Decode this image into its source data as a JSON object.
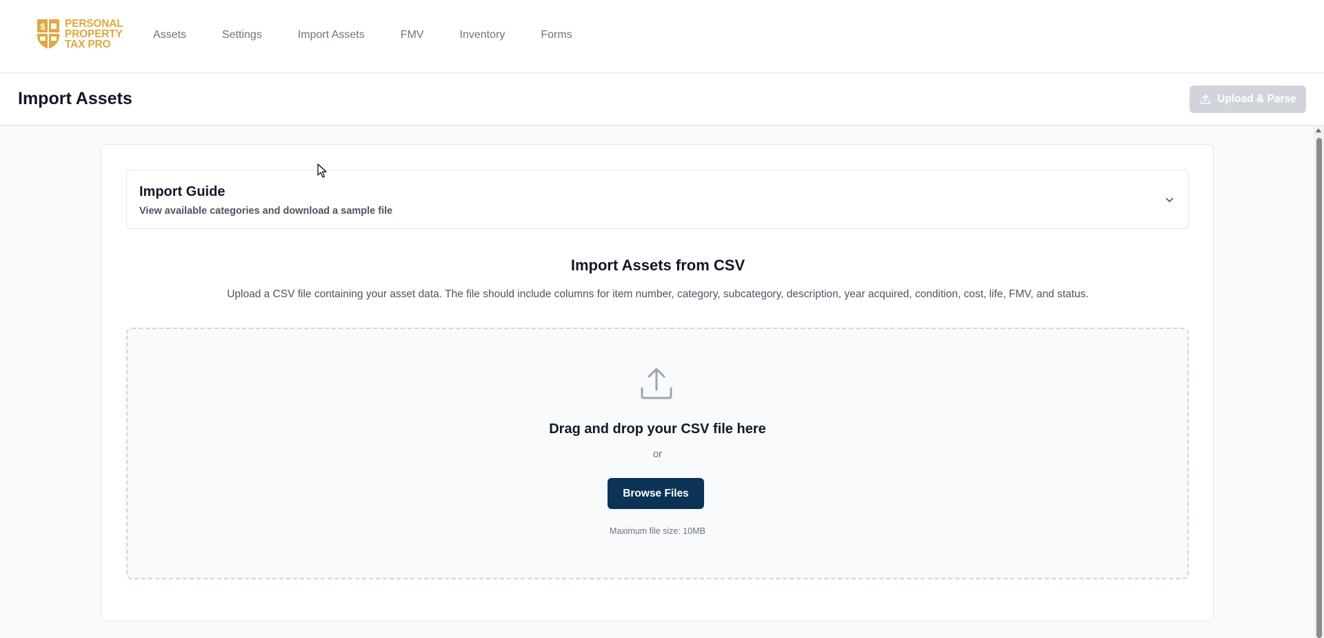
{
  "brand": {
    "lines": [
      "PERSONAL",
      "PROPERTY",
      "TAX PRO"
    ],
    "color": "#e0a83e",
    "shield_glyph": "$"
  },
  "nav": {
    "items": [
      {
        "label": "Assets"
      },
      {
        "label": "Settings"
      },
      {
        "label": "Import Assets"
      },
      {
        "label": "FMV"
      },
      {
        "label": "Inventory"
      },
      {
        "label": "Forms"
      }
    ]
  },
  "header": {
    "title": "Import Assets",
    "upload_button_label": "Upload & Parse",
    "upload_button_icon": "upload-icon",
    "upload_button_state": "disabled"
  },
  "guide": {
    "title": "Import Guide",
    "subtitle": "View available categories and download a sample file",
    "icon": "chevron-down-icon"
  },
  "import_section": {
    "title": "Import Assets from CSV",
    "description": "Upload a CSV file containing your asset data. The file should include columns for item number, category, subcategory, description, year acquired, condition, cost, life, FMV, and status."
  },
  "dropzone": {
    "icon": "upload-icon",
    "title": "Drag and drop your CSV file here",
    "or_text": "or",
    "browse_label": "Browse Files",
    "max_size_text": "Maximum file size: 10MB"
  },
  "colors": {
    "primary": "#0b3257",
    "brand_gold": "#e0a83e",
    "disabled_button": "#d1d5db"
  }
}
